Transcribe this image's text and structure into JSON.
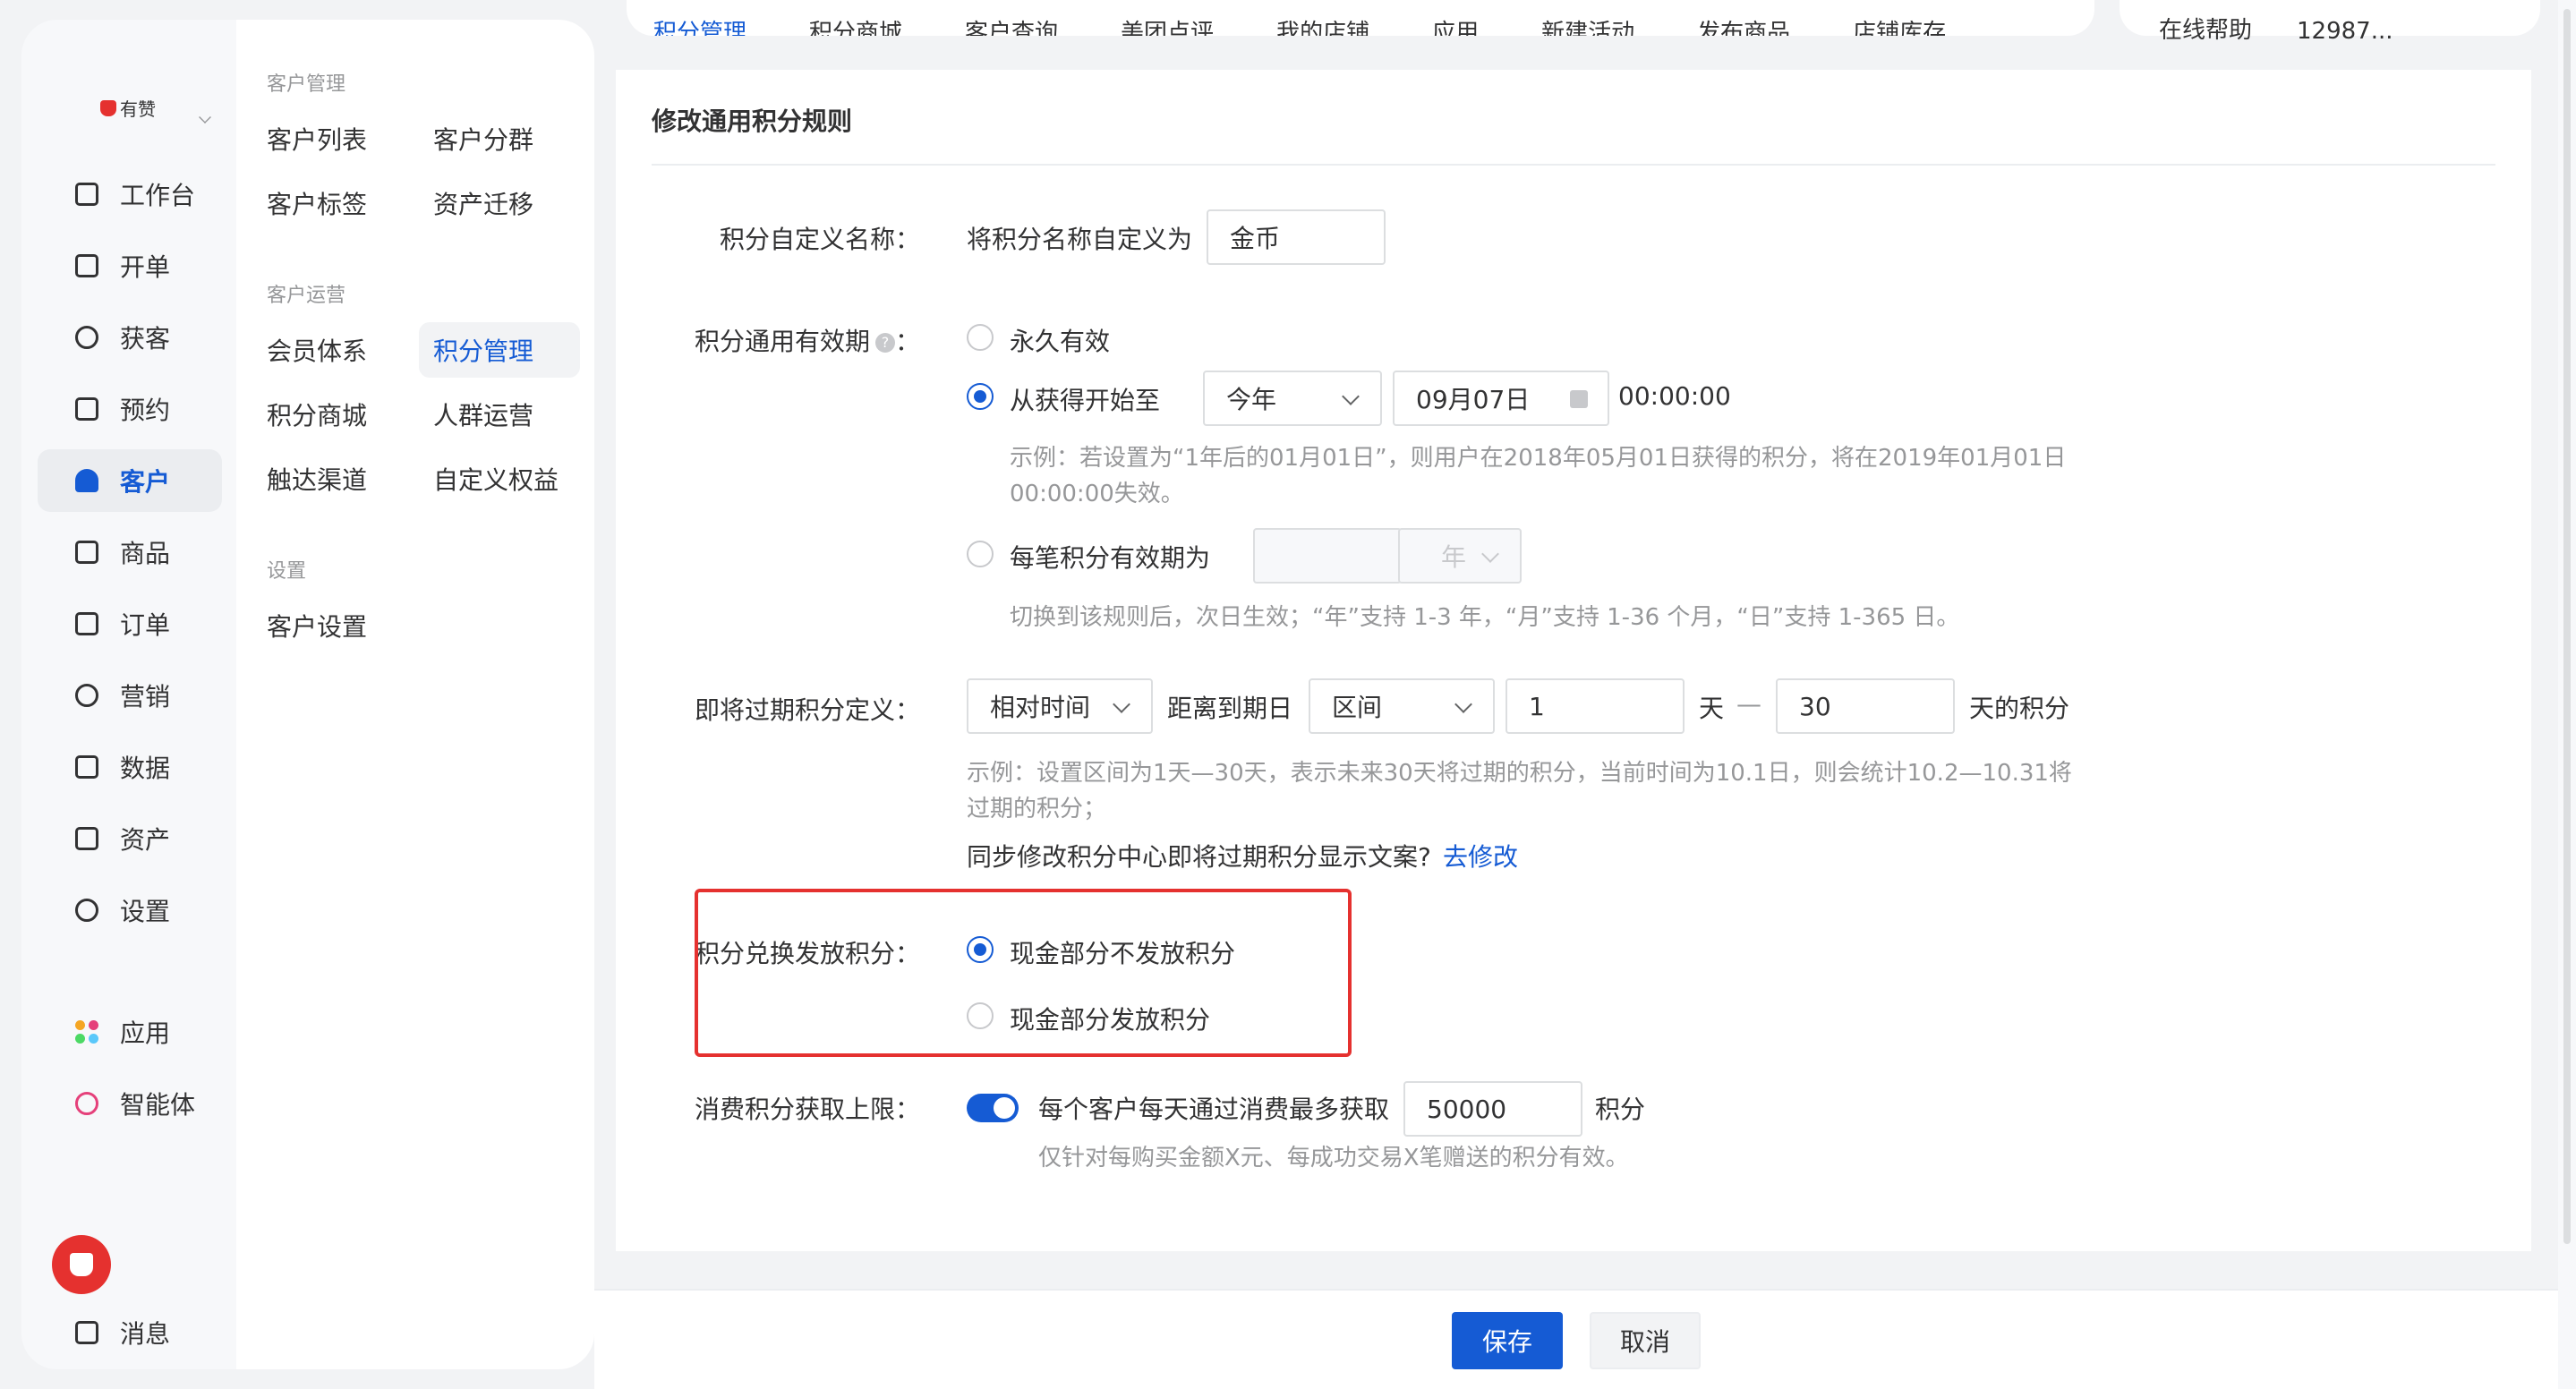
{
  "logo": {
    "text": "有赞"
  },
  "primary_nav": {
    "items": [
      {
        "label": "工作台",
        "icon": "workbench-icon"
      },
      {
        "label": "开单",
        "icon": "order-create-icon"
      },
      {
        "label": "获客",
        "icon": "acquire-icon"
      },
      {
        "label": "预约",
        "icon": "calendar-icon"
      },
      {
        "label": "客户",
        "icon": "user-icon",
        "active": true
      },
      {
        "label": "商品",
        "icon": "bag-icon"
      },
      {
        "label": "订单",
        "icon": "document-icon"
      },
      {
        "label": "营销",
        "icon": "target-icon"
      },
      {
        "label": "数据",
        "icon": "chart-icon"
      },
      {
        "label": "资产",
        "icon": "asset-icon"
      },
      {
        "label": "设置",
        "icon": "gear-icon"
      }
    ],
    "apps_label": "应用",
    "agent_label": "智能体",
    "message_label": "消息"
  },
  "secondary_nav": {
    "groups": [
      {
        "title": "客户管理",
        "items": [
          "客户列表",
          "客户分群",
          "客户标签",
          "资产迁移"
        ]
      },
      {
        "title": "客户运营",
        "items": [
          "会员体系",
          "积分管理",
          "积分商城",
          "人群运营",
          "触达渠道",
          "自定义权益"
        ]
      },
      {
        "title": "设置",
        "items": [
          "客户设置"
        ]
      }
    ],
    "active_item": "积分管理"
  },
  "top_tabs": [
    "积分管理",
    "积分商城",
    "客户查询",
    "美团点评",
    "我的店铺",
    "应用",
    "新建活动",
    "发布商品",
    "店铺库存"
  ],
  "top_right": {
    "help": "在线帮助",
    "account": "12987..."
  },
  "card": {
    "title": "修改通用积分规则",
    "name_field": {
      "label": "积分自定义名称：",
      "prefix": "将积分名称自定义为",
      "value": "金币"
    },
    "validity": {
      "label": "积分通用有效期",
      "colon": "：",
      "help_glyph": "?",
      "opt_forever": "永久有效",
      "opt_from_start": "从获得开始至",
      "year_select": "今年",
      "date_value": "09月07日",
      "time_value": "00:00:00",
      "hint_line1": "示例：若设置为“1年后的01月01日”，则用户在2018年05月01日获得的积分，将在2019年01月01日",
      "hint_line2": "00:00:00失效。",
      "opt_each": "每笔积分有效期为",
      "unit_select": "年",
      "hint_each": "切换到该规则后，次日生效；“年”支持 1-3 年，“月”支持 1-36 个月，“日”支持 1-365 日。"
    },
    "expiring": {
      "label": "即将过期积分定义：",
      "type_select": "相对时间",
      "distance_label": "距离到期日",
      "range_select": "区间",
      "from_value": "1",
      "day_unit": "天",
      "dash": "—",
      "to_value": "30",
      "suffix": "天的积分",
      "hint_line1": "示例：设置区间为1天—30天，表示未来30天将过期的积分，当前时间为10.1日，则会统计10.2—10.31将",
      "hint_line2": "过期的积分；",
      "sync_text": "同步修改积分中心即将过期积分显示文案?",
      "sync_link": "去修改"
    },
    "exchange": {
      "label": "积分兑换发放积分：",
      "opt_no": "现金部分不发放积分",
      "opt_yes": "现金部分发放积分"
    },
    "limit": {
      "label": "消费积分获取上限：",
      "text": "每个客户每天通过消费最多获取",
      "value": "50000",
      "unit": "积分",
      "hint": "仅针对每购买金额X元、每成功交易X笔赠送的积分有效。"
    }
  },
  "footer": {
    "save": "保存",
    "cancel": "取消"
  },
  "colors": {
    "primary": "#155bd4",
    "highlight": "#e5312f",
    "brand": "#e5312f"
  }
}
